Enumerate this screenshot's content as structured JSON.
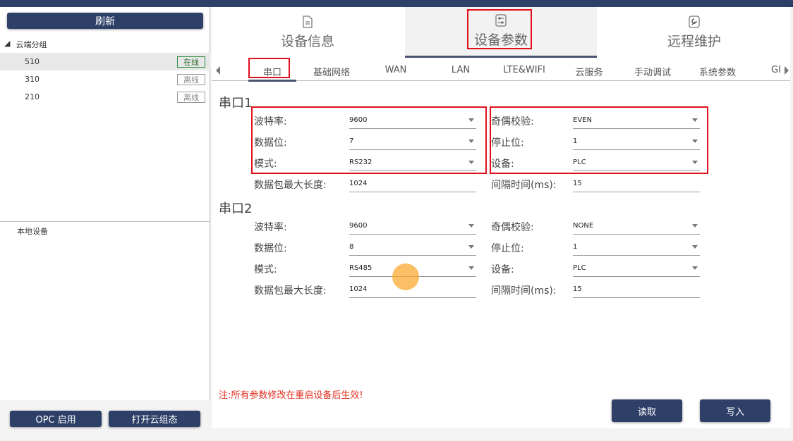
{
  "sidebar": {
    "refresh_label": "刷新",
    "group_label": "云端分组",
    "devices": [
      {
        "name": "510",
        "status": "在线"
      },
      {
        "name": "310",
        "status": "离线"
      },
      {
        "name": "210",
        "status": "离线"
      }
    ],
    "local_label": "本地设备",
    "opc_label": "OPC 启用",
    "cloud_label": "打开云组态"
  },
  "main_tabs": [
    {
      "label": "设备信息",
      "icon": "document-icon"
    },
    {
      "label": "设备参数",
      "icon": "sliders-icon"
    },
    {
      "label": "远程维护",
      "icon": "wrench-icon"
    }
  ],
  "sub_tabs": [
    "串口",
    "基础网络",
    "WAN",
    "LAN",
    "LTE&WIFI",
    "云服务",
    "手动调试",
    "系统参数",
    "GI"
  ],
  "serial1": {
    "title": "串口1",
    "baud_label": "波特率:",
    "baud": "9600",
    "data_bits_label": "数据位:",
    "data_bits": "7",
    "mode_label": "模式:",
    "mode": "RS232",
    "max_len_label": "数据包最大长度:",
    "max_len": "1024",
    "parity_label": "奇偶校验:",
    "parity": "EVEN",
    "stop_label": "停止位:",
    "stop": "1",
    "device_label": "设备:",
    "device": "PLC",
    "interval_label": "间隔时间(ms):",
    "interval": "15"
  },
  "serial2": {
    "title": "串口2",
    "baud_label": "波特率:",
    "baud": "9600",
    "data_bits_label": "数据位:",
    "data_bits": "8",
    "mode_label": "模式:",
    "mode": "RS485",
    "max_len_label": "数据包最大长度:",
    "max_len": "1024",
    "parity_label": "奇偶校验:",
    "parity": "NONE",
    "stop_label": "停止位:",
    "stop": "1",
    "device_label": "设备:",
    "device": "PLC",
    "interval_label": "间隔时间(ms):",
    "interval": "15"
  },
  "note": "注:所有参数修改在重启设备后生效!",
  "read_label": "读取",
  "write_label": "写入",
  "colors": {
    "accent": "#2e4068",
    "highlight": "#e0101a",
    "online": "#2a8a3a",
    "note": "#e03020"
  }
}
